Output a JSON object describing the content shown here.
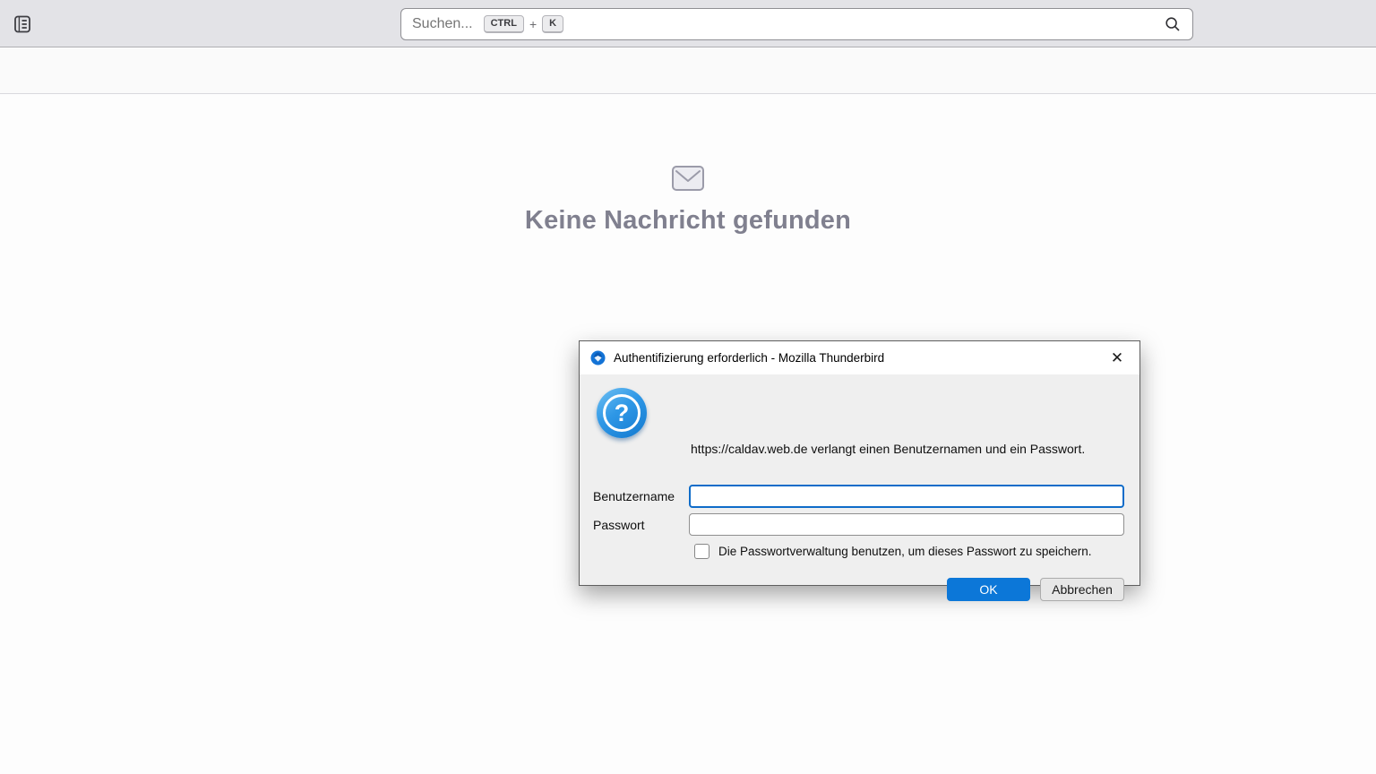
{
  "topbar": {
    "search": {
      "placeholder": "Suchen...",
      "shortcut": {
        "keys": [
          "CTRL",
          "K"
        ],
        "separator": "+"
      }
    }
  },
  "content": {
    "empty_title": "Keine Nachricht gefunden"
  },
  "dialog": {
    "title": "Authentifizierung erforderlich - Mozilla Thunderbird",
    "close_glyph": "✕",
    "question_glyph": "?",
    "message": "https://caldav.web.de verlangt einen Benutzernamen und ein Passwort.",
    "username": {
      "label": "Benutzername",
      "value": ""
    },
    "password": {
      "label": "Passwort",
      "value": ""
    },
    "save_checkbox": {
      "label": "Die Passwortverwaltung benutzen, um dieses Passwort zu speichern.",
      "checked": false
    },
    "buttons": {
      "ok": "OK",
      "cancel": "Abbrechen"
    }
  },
  "colors": {
    "accent_blue": "#0c77d8",
    "focus_blue": "#0f6cc9",
    "empty_text": "#80808f",
    "topbar_bg": "#e3e3e7"
  }
}
